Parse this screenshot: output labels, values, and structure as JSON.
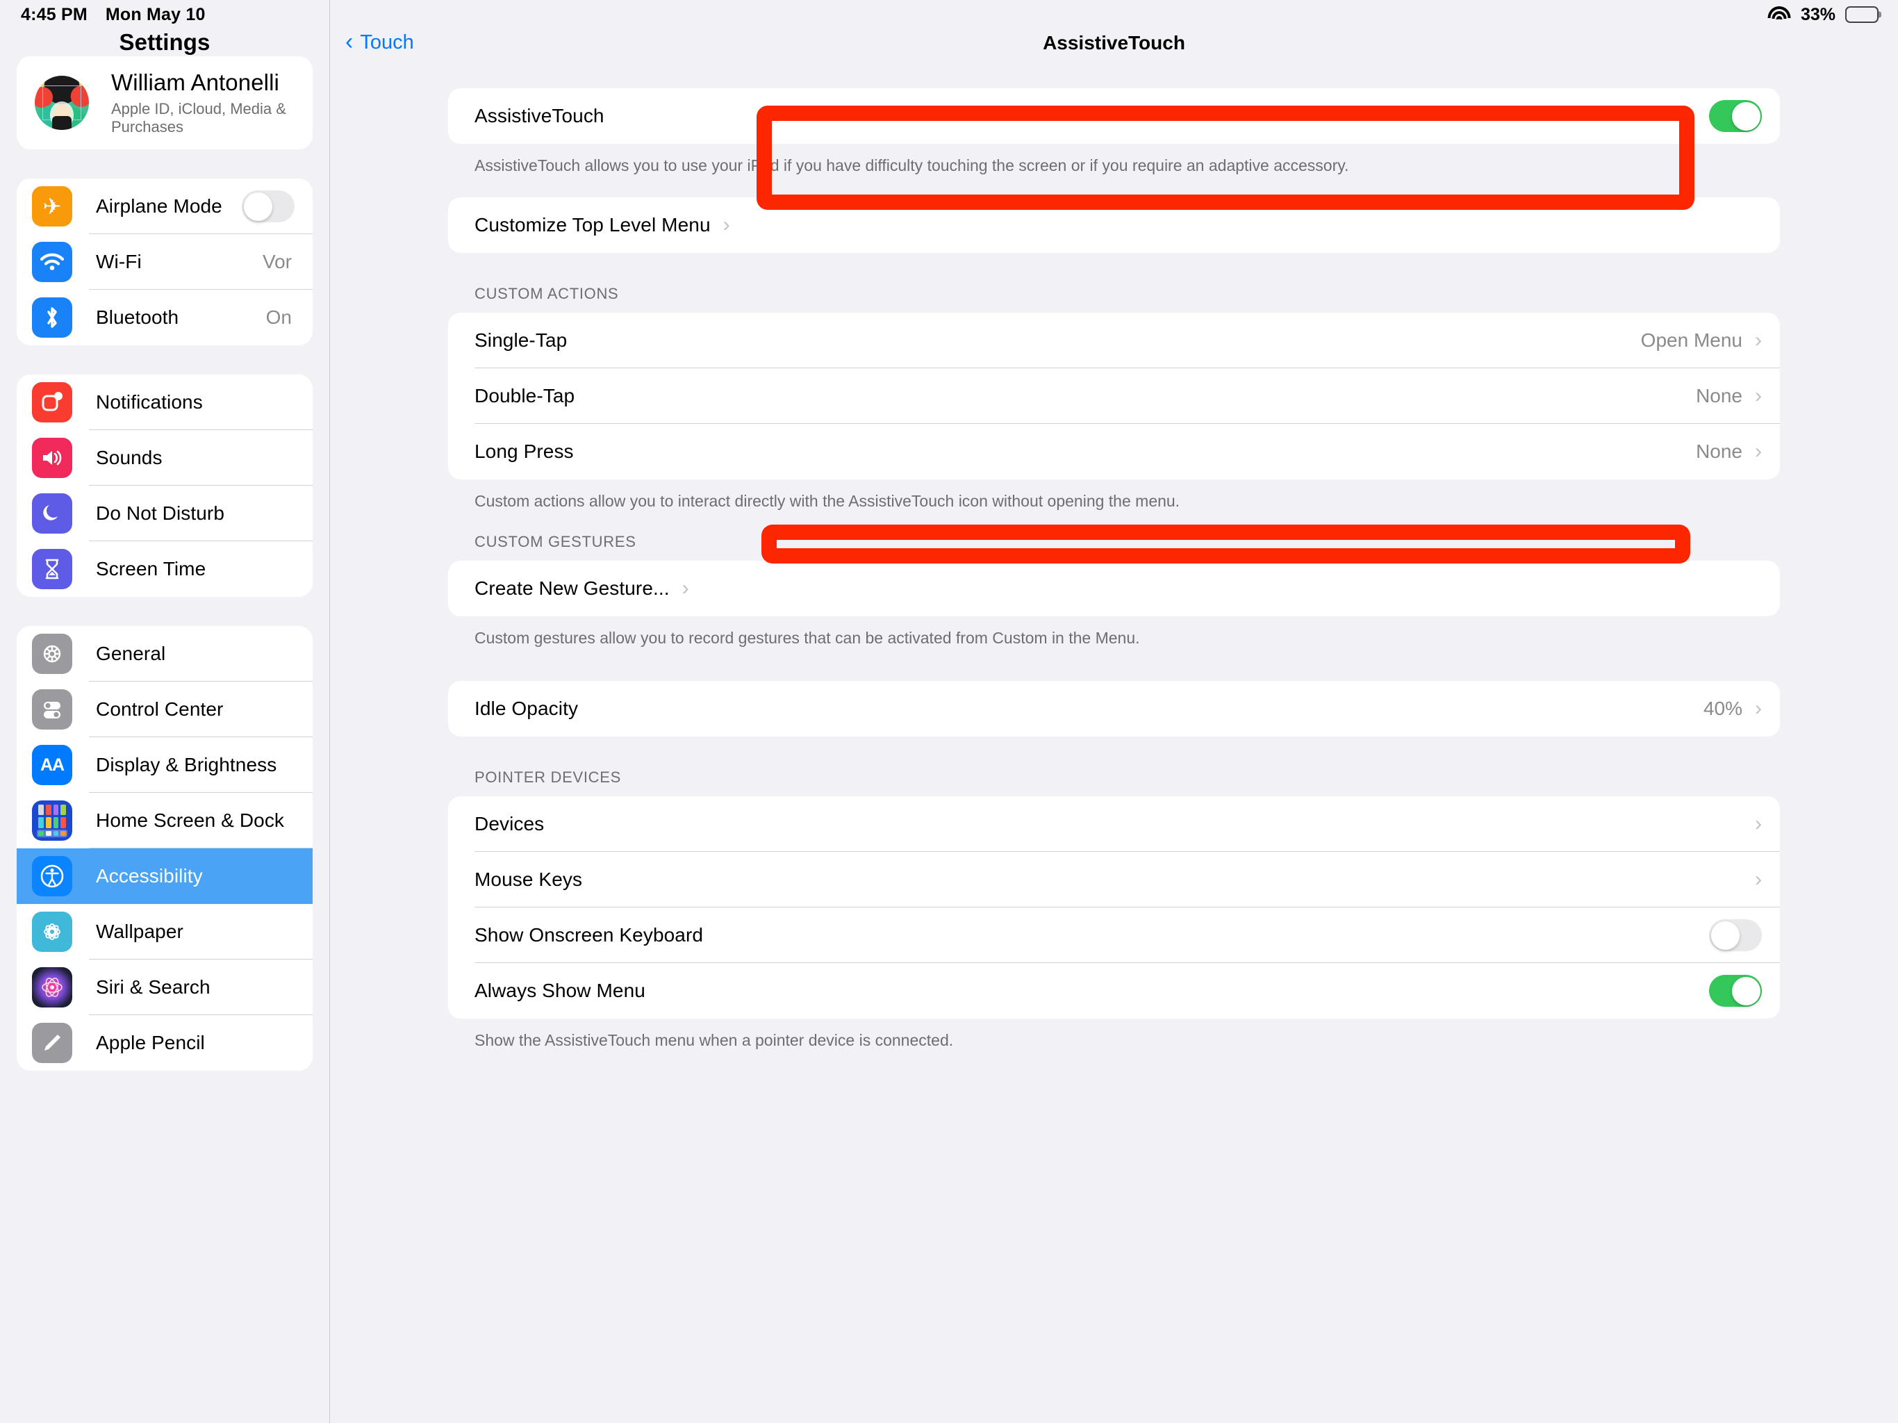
{
  "status_bar": {
    "time": "4:45 PM",
    "date": "Mon May 10",
    "battery_percent": "33%",
    "wifi_icon": "wifi-icon",
    "battery_icon": "battery-icon"
  },
  "sidebar": {
    "title": "Settings",
    "profile": {
      "name": "William Antonelli",
      "subtitle": "Apple ID, iCloud, Media & Purchases"
    },
    "groups": [
      {
        "items": [
          {
            "label": "Airplane Mode",
            "icon": "airplane-icon",
            "control": "toggle",
            "toggle_on": false
          },
          {
            "label": "Wi-Fi",
            "icon": "wifi-icon",
            "control": "value",
            "value": "Vor"
          },
          {
            "label": "Bluetooth",
            "icon": "bluetooth-icon",
            "control": "value",
            "value": "On"
          }
        ]
      },
      {
        "items": [
          {
            "label": "Notifications",
            "icon": "notifications-icon"
          },
          {
            "label": "Sounds",
            "icon": "sounds-icon"
          },
          {
            "label": "Do Not Disturb",
            "icon": "moon-icon"
          },
          {
            "label": "Screen Time",
            "icon": "hourglass-icon"
          }
        ]
      },
      {
        "items": [
          {
            "label": "General",
            "icon": "gear-icon"
          },
          {
            "label": "Control Center",
            "icon": "control-center-icon"
          },
          {
            "label": "Display & Brightness",
            "icon": "display-brightness-icon"
          },
          {
            "label": "Home Screen & Dock",
            "icon": "home-screen-dock-icon"
          },
          {
            "label": "Accessibility",
            "icon": "accessibility-icon",
            "selected": true
          },
          {
            "label": "Wallpaper",
            "icon": "wallpaper-icon"
          },
          {
            "label": "Siri & Search",
            "icon": "siri-icon"
          },
          {
            "label": "Apple Pencil",
            "icon": "apple-pencil-icon"
          }
        ]
      }
    ]
  },
  "detail": {
    "back_label": "Touch",
    "title": "AssistiveTouch",
    "assistivetouch": {
      "label": "AssistiveTouch",
      "toggle_on": true,
      "description": "AssistiveTouch allows you to use your iPad if you have difficulty touching the screen or if you require an adaptive accessory."
    },
    "customize_row": {
      "label": "Customize Top Level Menu"
    },
    "custom_actions": {
      "header": "CUSTOM ACTIONS",
      "rows": [
        {
          "label": "Single-Tap",
          "value": "Open Menu"
        },
        {
          "label": "Double-Tap",
          "value": "None"
        },
        {
          "label": "Long Press",
          "value": "None"
        }
      ],
      "footer": "Custom actions allow you to interact directly with the AssistiveTouch icon without opening the menu."
    },
    "custom_gestures": {
      "header": "CUSTOM GESTURES",
      "rows": [
        {
          "label": "Create New Gesture..."
        }
      ],
      "footer": "Custom gestures allow you to record gestures that can be activated from Custom in the Menu."
    },
    "idle_opacity": {
      "label": "Idle Opacity",
      "value": "40%"
    },
    "pointer_devices": {
      "header": "POINTER DEVICES",
      "rows": [
        {
          "label": "Devices",
          "control": "chevron"
        },
        {
          "label": "Mouse Keys",
          "control": "chevron"
        },
        {
          "label": "Show Onscreen Keyboard",
          "control": "toggle",
          "toggle_on": false
        },
        {
          "label": "Always Show Menu",
          "control": "toggle",
          "toggle_on": true
        }
      ],
      "footer": "Show the AssistiveTouch menu when a pointer device is connected."
    }
  },
  "annotations": {
    "highlight_color": "#fc2600",
    "boxes": [
      {
        "name": "assistivetouch-highlight"
      },
      {
        "name": "double-tap-highlight"
      }
    ]
  }
}
